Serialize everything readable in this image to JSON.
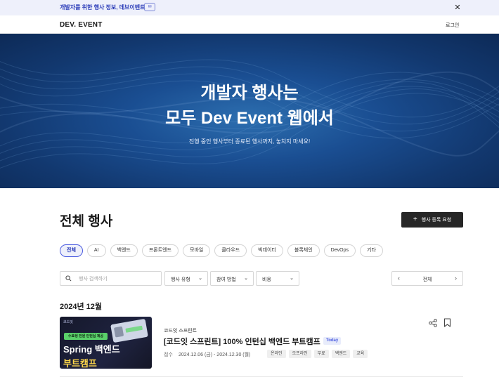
{
  "banner": {
    "text": "개발자를 위한 행사 정보, 데브이벤트",
    "badge_icon": "chat-icon",
    "close_icon": "close-icon"
  },
  "header": {
    "logo": "DEV. EVENT",
    "login": "로그인"
  },
  "hero": {
    "title_line1": "개발자 행사는",
    "title_line2": "모두 Dev Event 웹에서",
    "subtitle": "진행 중인 행사부터 종료된 행사까지, 놓치지 마세요!"
  },
  "section": {
    "title": "전체 행사",
    "request_button": "행사 등록 요청"
  },
  "categories": [
    "전체",
    "AI",
    "백엔드",
    "프론트엔드",
    "모바일",
    "클라우드",
    "빅데이터",
    "블록체인",
    "DevOps",
    "기타"
  ],
  "active_category": "전체",
  "filters": {
    "search_placeholder": "행사 검색하기",
    "event_type": "행사 유형",
    "join_method": "참여 방법",
    "cost": "비용",
    "month_nav": "전체"
  },
  "month_heading": "2024년 12월",
  "event": {
    "thumb_logo": "코드잇",
    "thumb_badge": "수료생 전원 인턴십 제공",
    "thumb_line1": "Spring 백엔드",
    "thumb_line2": "부트캠프",
    "organizer": "코드잇 스프린트",
    "title": "[코드잇 스프린트] 100% 인턴십 백엔드 부트캠프",
    "today_badge": "Today",
    "date_label": "접수",
    "date_range": "2024.12.06 (금) - 2024.12.30 (월)",
    "tags": [
      "온라인",
      "오프라인",
      "무료",
      "백엔드",
      "교육"
    ],
    "share_icon": "share-icon",
    "bookmark_icon": "bookmark-icon"
  },
  "colors": {
    "accent": "#4a5be0",
    "banner_bg": "#eef0fb",
    "hero_bg": "#1a4e92",
    "button_dark": "#262626"
  }
}
